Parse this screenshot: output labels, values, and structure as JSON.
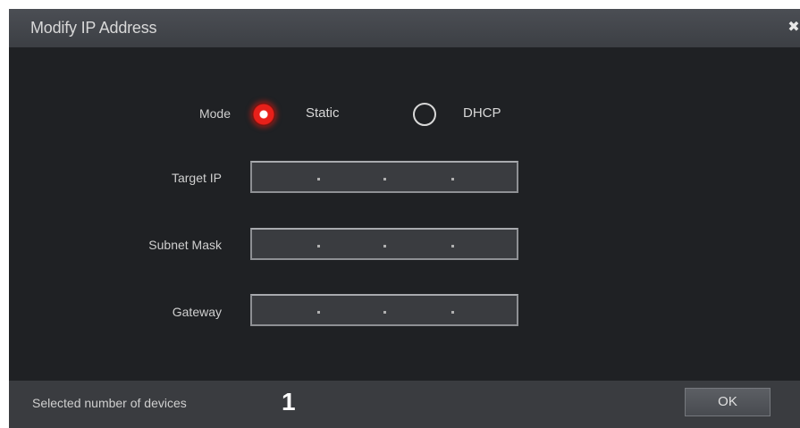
{
  "dialog": {
    "title": "Modify IP Address",
    "close_icon": "close-icon"
  },
  "form": {
    "mode_label": "Mode",
    "mode_options": [
      {
        "label": "Static",
        "selected": true
      },
      {
        "label": "DHCP",
        "selected": false
      }
    ],
    "fields": [
      {
        "label": "Target IP",
        "value": ""
      },
      {
        "label": "Subnet Mask",
        "value": ""
      },
      {
        "label": "Gateway",
        "value": ""
      }
    ]
  },
  "footer": {
    "selected_label": "Selected number of devices",
    "selected_count": "1",
    "ok_label": "OK"
  },
  "colors": {
    "background": "#1f2124",
    "titlebar": "#3c3f44",
    "radio_selected": "#e8201a",
    "footer": "#3a3c40"
  }
}
